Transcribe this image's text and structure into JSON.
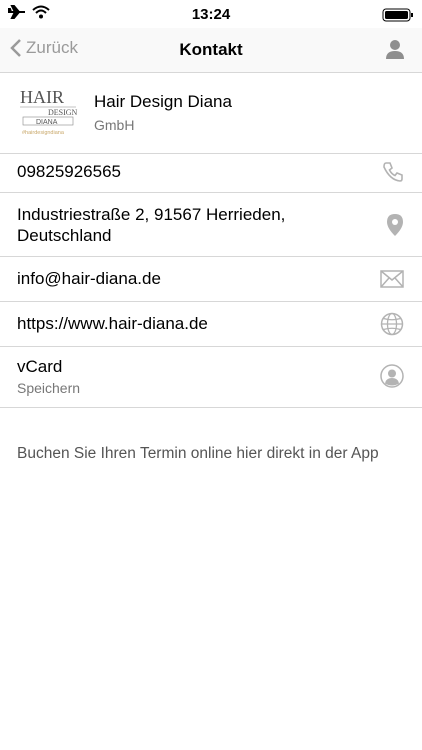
{
  "status": {
    "time": "13:24"
  },
  "nav": {
    "back_label": "Zurück",
    "title": "Kontakt"
  },
  "company": {
    "name": "Hair Design Diana",
    "legal": "GmbH"
  },
  "contact": {
    "phone": "09825926565",
    "address_line1": "Industriestraße 2, 91567 Herrieden,",
    "address_line2": "Deutschland",
    "email": "info@hair-diana.de",
    "website": "https://www.hair-diana.de",
    "vcard_label": "vCard",
    "vcard_sub": "Speichern"
  },
  "footer": {
    "booking_text": "Buchen Sie Ihren Termin online hier direkt in der App"
  },
  "logo": {
    "line1": "HAIR",
    "line2": "DESIGN",
    "line3": "DIANA",
    "tag": "#hairdesigndiana"
  },
  "colors": {
    "icon_gray": "#b3b3b3",
    "separator": "#d7d7d7",
    "nav_gray": "#9a9a9a"
  }
}
